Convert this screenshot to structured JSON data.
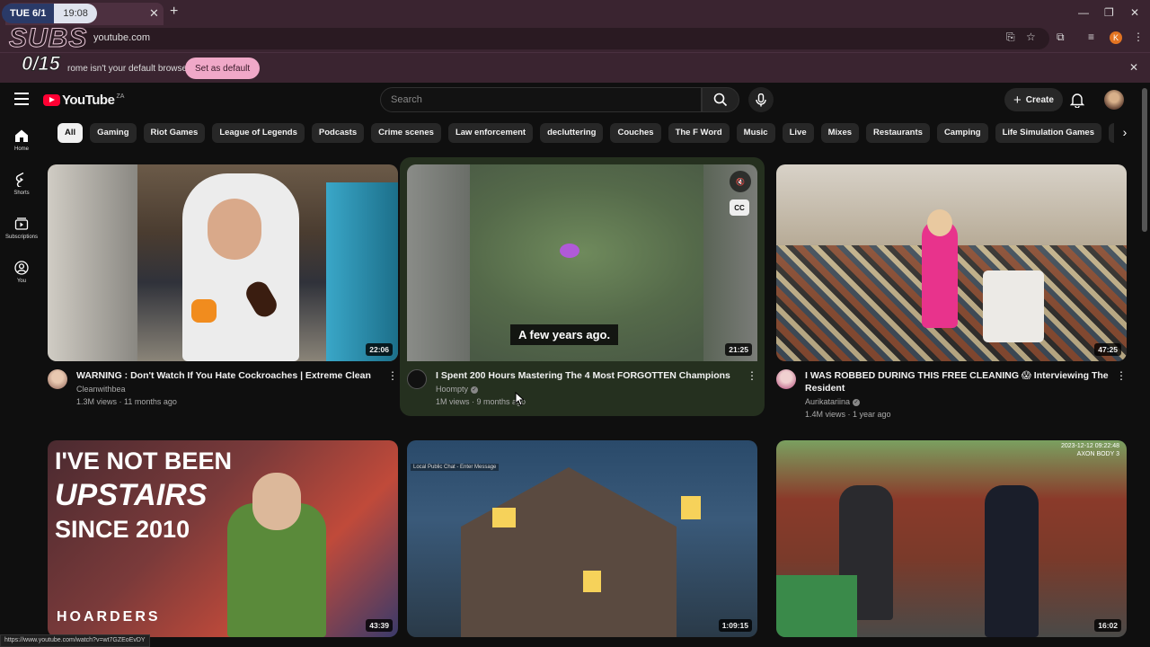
{
  "browser": {
    "clock_day": "TUE 6/1",
    "clock_time": "19:08",
    "tab_close": "✕",
    "new_tab": "+",
    "url": "youtube.com",
    "profile_initial": "K",
    "infobar_text": "rome isn't your default browser",
    "set_default_label": "Set as default",
    "status_url": "https://www.youtube.com/watch?v=wt7GZEoEvDY"
  },
  "overlay": {
    "subs_label": "SUBS",
    "subs_count": "0/15"
  },
  "youtube": {
    "logo_text": "YouTube",
    "country_code": "ZA",
    "search_placeholder": "Search",
    "create_label": "Create",
    "sidebar": [
      {
        "label": "Home",
        "icon": "home-icon"
      },
      {
        "label": "Shorts",
        "icon": "shorts-icon"
      },
      {
        "label": "Subscriptions",
        "icon": "subscriptions-icon"
      },
      {
        "label": "You",
        "icon": "you-icon"
      }
    ],
    "chips": [
      "All",
      "Gaming",
      "Riot Games",
      "League of Legends",
      "Podcasts",
      "Crime scenes",
      "Law enforcement",
      "decluttering",
      "Couches",
      "The F Word",
      "Music",
      "Live",
      "Mixes",
      "Restaurants",
      "Camping",
      "Life Simulation Games",
      "Action-adventu"
    ],
    "videos": [
      {
        "title": "WARNING : Don't Watch If You Hate Cockroaches | Extreme Clean",
        "channel": "Cleanwithbea",
        "stats": "1.3M views · 11 months ago",
        "duration": "22:06",
        "verified": false
      },
      {
        "title": "I Spent 200 Hours Mastering The 4 Most FORGOTTEN Champions",
        "channel": "Hoompty",
        "stats": "1M views · 9 months ago",
        "duration": "21:25",
        "verified": true,
        "subtitle": "A few years ago."
      },
      {
        "title": "I WAS ROBBED DURING THIS FREE CLEANING 😱 Interviewing The Resident",
        "channel": "Aurikatariina",
        "stats": "1.4M views · 1 year ago",
        "duration": "47:25",
        "verified": true
      },
      {
        "duration": "43:39",
        "thumb_text_1": "I'VE NOT BEEN",
        "thumb_text_2": "UPSTAIRS",
        "thumb_text_3": "SINCE 2010",
        "thumb_text_4": "HOARDERS"
      },
      {
        "duration": "1:09:15",
        "thumb_text_1": "Local Public Chat - Enter Message"
      },
      {
        "duration": "16:02",
        "thumb_text_1": "2023-12-12 09:22:48",
        "thumb_text_2": "AXON BODY 3"
      }
    ]
  },
  "colors": {
    "bg": "#0f0f0f",
    "chrome": "#3a2430",
    "brand_red": "#ff0033",
    "set_default": "#f0a8c8"
  }
}
